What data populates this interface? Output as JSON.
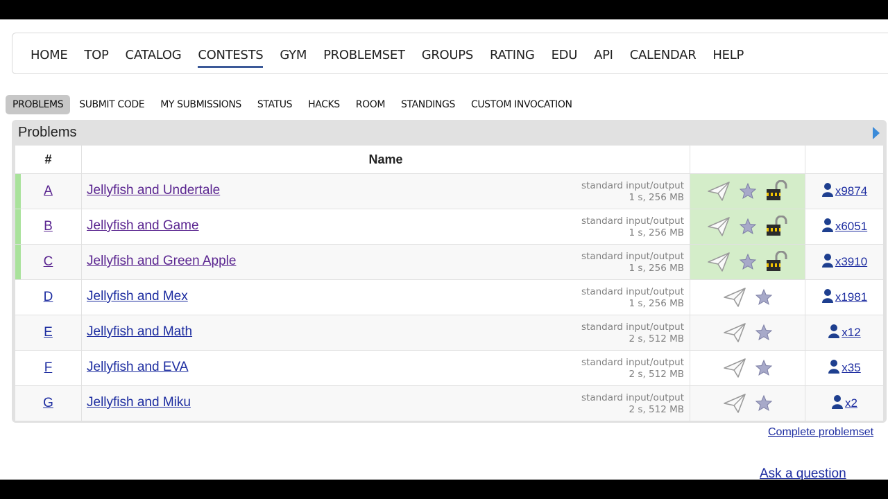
{
  "menu": {
    "items": [
      {
        "label": "HOME"
      },
      {
        "label": "TOP"
      },
      {
        "label": "CATALOG"
      },
      {
        "label": "CONTESTS",
        "active": true
      },
      {
        "label": "GYM"
      },
      {
        "label": "PROBLEMSET"
      },
      {
        "label": "GROUPS"
      },
      {
        "label": "RATING"
      },
      {
        "label": "EDU"
      },
      {
        "label": "API"
      },
      {
        "label": "CALENDAR"
      },
      {
        "label": "HELP"
      }
    ]
  },
  "submenu": {
    "items": [
      {
        "label": "PROBLEMS",
        "active": true
      },
      {
        "label": "SUBMIT CODE"
      },
      {
        "label": "MY SUBMISSIONS"
      },
      {
        "label": "STATUS"
      },
      {
        "label": "HACKS"
      },
      {
        "label": "ROOM"
      },
      {
        "label": "STANDINGS"
      },
      {
        "label": "CUSTOM INVOCATION"
      }
    ]
  },
  "problems": {
    "title": "Problems",
    "columns": {
      "id": "#",
      "name": "Name",
      "actions": "",
      "users": ""
    },
    "rows": [
      {
        "id": "A",
        "name": "Jellyfish and Undertale",
        "io": "standard input/output",
        "limits": "1 s, 256 MB",
        "users": "x9874",
        "solved": true
      },
      {
        "id": "B",
        "name": "Jellyfish and Game",
        "io": "standard input/output",
        "limits": "1 s, 256 MB",
        "users": "x6051",
        "solved": true
      },
      {
        "id": "C",
        "name": "Jellyfish and Green Apple",
        "io": "standard input/output",
        "limits": "1 s, 256 MB",
        "users": "x3910",
        "solved": true
      },
      {
        "id": "D",
        "name": "Jellyfish and Mex",
        "io": "standard input/output",
        "limits": "1 s, 256 MB",
        "users": "x1981",
        "solved": false
      },
      {
        "id": "E",
        "name": "Jellyfish and Math",
        "io": "standard input/output",
        "limits": "2 s, 512 MB",
        "users": "x12",
        "solved": false
      },
      {
        "id": "F",
        "name": "Jellyfish and EVA",
        "io": "standard input/output",
        "limits": "2 s, 512 MB",
        "users": "x35",
        "solved": false
      },
      {
        "id": "G",
        "name": "Jellyfish and Miku",
        "io": "standard input/output",
        "limits": "2 s, 512 MB",
        "users": "x2",
        "solved": false
      }
    ]
  },
  "links": {
    "complete_problemset": "Complete problemset",
    "ask_question": "Ask a question"
  },
  "icons": {
    "submit": "paper-plane-icon",
    "favourite": "star-icon",
    "unlock": "padlock-icon",
    "users": "user-icon"
  },
  "colors": {
    "solved_bg": "#d4edc9",
    "solved_marker": "#a9e29b",
    "link": "#1c2ca0",
    "visited_link": "#5a2590",
    "menu_underline": "#3b5998"
  }
}
